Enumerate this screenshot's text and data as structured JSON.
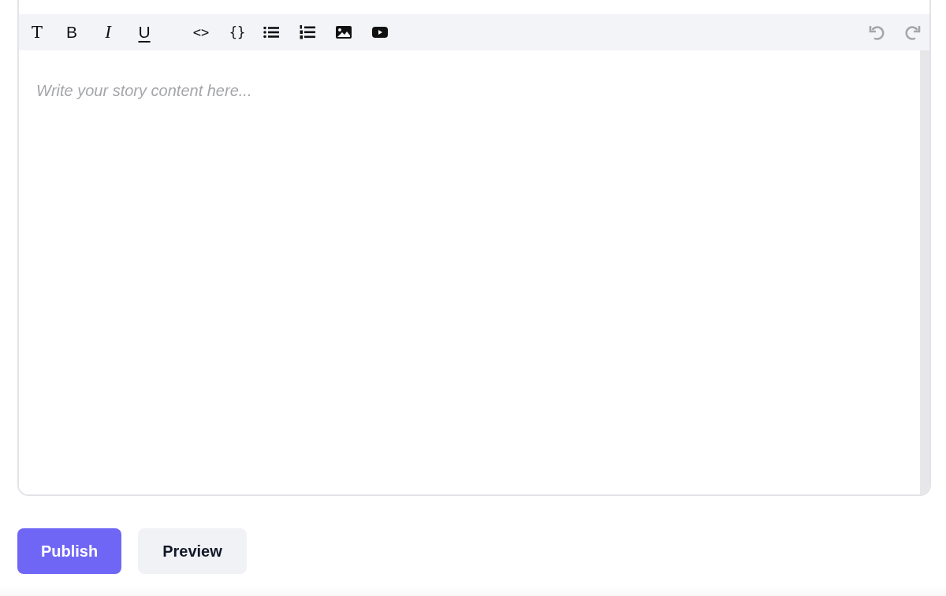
{
  "editor": {
    "toolbar": {
      "format": [
        {
          "kind": "text-style",
          "label": "T"
        },
        {
          "kind": "bold",
          "label": "B"
        },
        {
          "kind": "italic",
          "label": "I"
        },
        {
          "kind": "underline",
          "label": "U"
        }
      ],
      "insert": [
        {
          "kind": "code",
          "label": "<>"
        },
        {
          "kind": "code-block",
          "label": "{}"
        },
        {
          "kind": "bullet-list"
        },
        {
          "kind": "numbered-list"
        },
        {
          "kind": "image"
        },
        {
          "kind": "video"
        }
      ],
      "history": [
        {
          "kind": "undo",
          "disabled": true
        },
        {
          "kind": "redo",
          "disabled": true
        }
      ]
    },
    "placeholder": "Write your story content here..."
  },
  "actions": [
    {
      "kind": "primary",
      "label": "Publish"
    },
    {
      "kind": "secondary",
      "label": "Preview"
    }
  ]
}
